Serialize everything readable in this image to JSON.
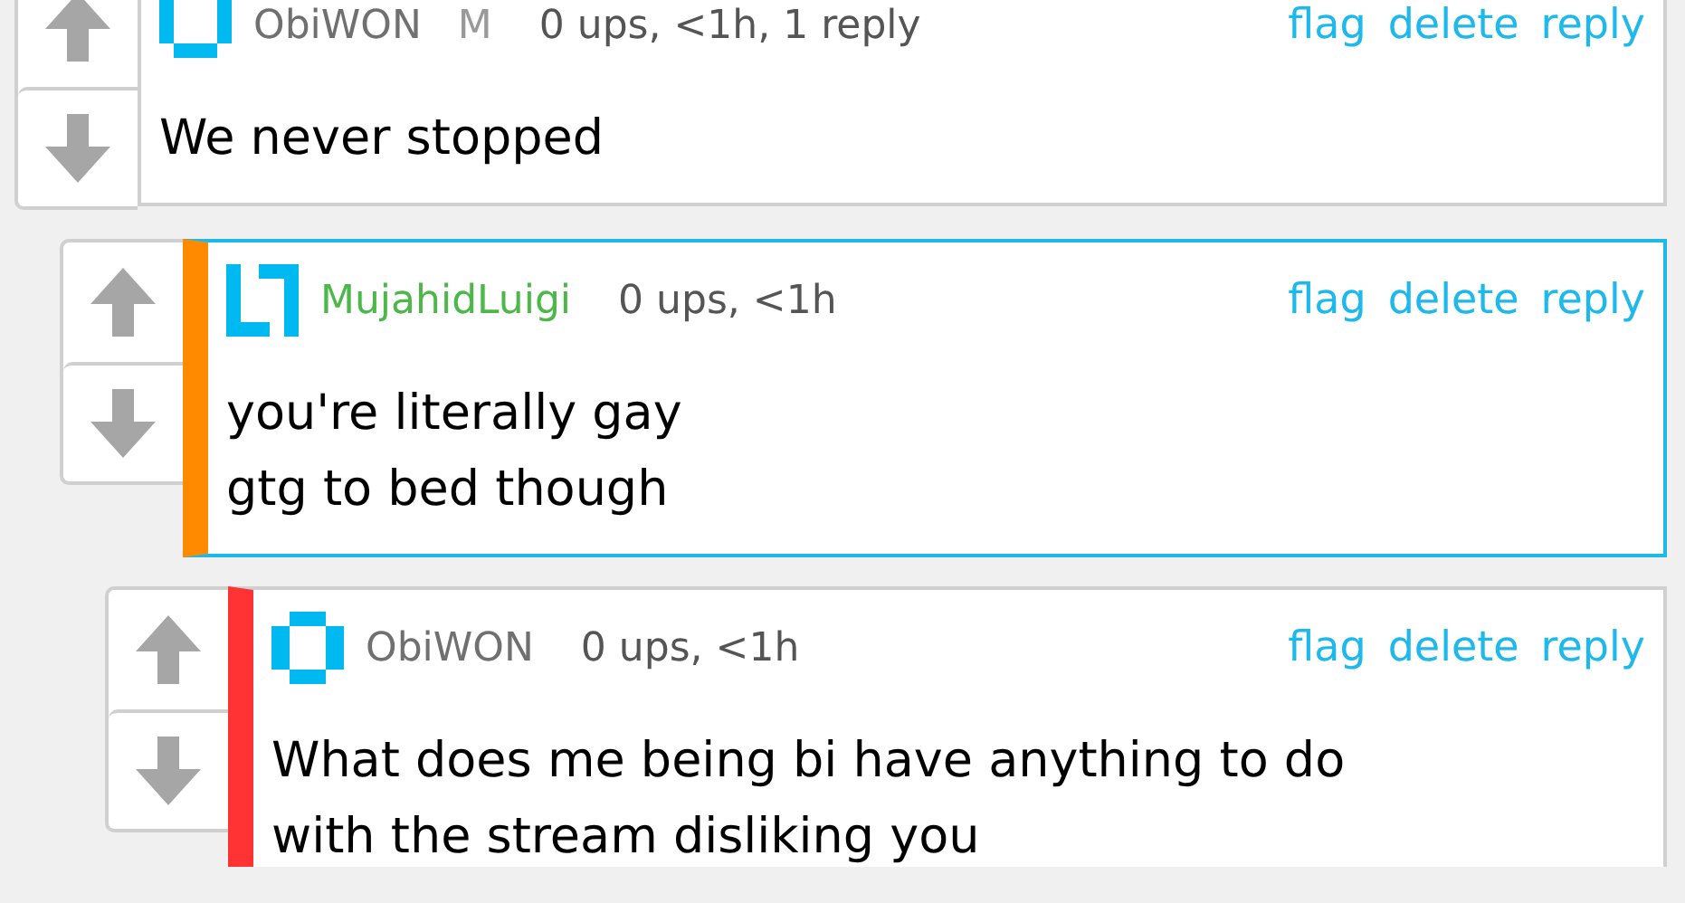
{
  "comments": [
    {
      "kind": "cup",
      "user": {
        "name": "ObiWON",
        "color": "#707070"
      },
      "badge": "M",
      "meta": "0 ups, <1h, 1 reply",
      "actions": [
        "flag",
        "delete",
        "reply"
      ],
      "highlighted": false,
      "body": [
        "We never stopped"
      ]
    },
    {
      "kind": "bracket",
      "user": {
        "name": "MujahidLuigi",
        "color": "#4db84a"
      },
      "meta": "0 ups, <1h",
      "actions": [
        "flag",
        "delete",
        "reply"
      ],
      "highlighted": true,
      "color": "#ff8a00",
      "body": [
        "you're literally gay",
        "gtg to bed though"
      ]
    },
    {
      "kind": "ring",
      "user": {
        "name": "ObiWON",
        "color": "#707070"
      },
      "meta": "0 ups, <1h",
      "actions": [
        "flag",
        "delete",
        "reply"
      ],
      "highlighted": false,
      "color": "#ff3333",
      "body": [
        "What does me being bi have anything to do",
        "with the stream disliking you"
      ]
    }
  ]
}
